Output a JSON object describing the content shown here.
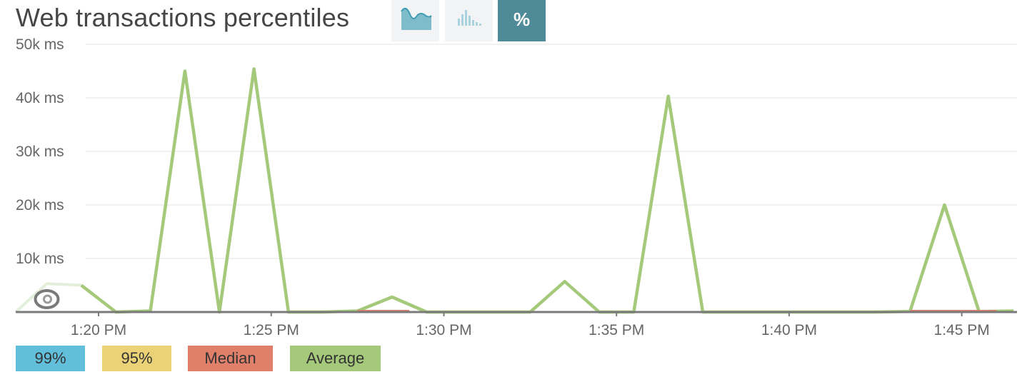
{
  "title": "Web transactions percentiles",
  "toolbar": {
    "area_chart_button": "area-chart-icon",
    "histogram_button": "histogram-icon",
    "percentile_button": "%",
    "active_color": "#4f8a99"
  },
  "chart_data": {
    "type": "line",
    "yticks": [
      "50k ms",
      "40k ms",
      "30k ms",
      "20k ms",
      "10k ms"
    ],
    "ylim": [
      0,
      50000
    ],
    "xticks": [
      "1:20 PM",
      "1:25 PM",
      "1:30 PM",
      "1:35 PM",
      "1:40 PM",
      "1:45 PM"
    ],
    "xtick_minutes": [
      20,
      25,
      30,
      35,
      40,
      45
    ],
    "xlim_minutes": [
      17.6,
      46.6
    ],
    "grid": true,
    "series": [
      {
        "name": "Average",
        "color": "#a5c97a",
        "x": [
          19.5,
          20.5,
          21.5,
          22.5,
          23.5,
          24.5,
          25.5,
          26.5,
          27.5,
          28.5,
          29.5,
          30.5,
          31.5,
          32.5,
          33.5,
          34.5,
          35.5,
          36.5,
          37.5,
          38.5,
          39.5,
          40.5,
          41.5,
          42.5,
          43.5,
          44.5,
          45.5,
          46.5
        ],
        "y": [
          5000,
          0,
          200,
          45000,
          0,
          45400,
          0,
          0,
          200,
          2800,
          0,
          0,
          0,
          0,
          5700,
          0,
          0,
          40300,
          0,
          0,
          0,
          0,
          0,
          0,
          100,
          20000,
          100,
          200
        ]
      },
      {
        "name": "Median",
        "color": "#e07f6a",
        "x": [
          27.5,
          29.0,
          43.5,
          46.0
        ],
        "y": [
          0,
          0,
          0,
          0
        ]
      }
    ],
    "faded_segment": {
      "x": [
        17.6,
        18.5,
        19.5
      ],
      "y": [
        0,
        5300,
        5000
      ],
      "color": "#e3eedb"
    }
  },
  "legend": [
    {
      "label": "99%",
      "color": "#62bfdb"
    },
    {
      "label": "95%",
      "color": "#ecd276"
    },
    {
      "label": "Median",
      "color": "#e07f6a"
    },
    {
      "label": "Average",
      "color": "#a5c97a"
    }
  ]
}
